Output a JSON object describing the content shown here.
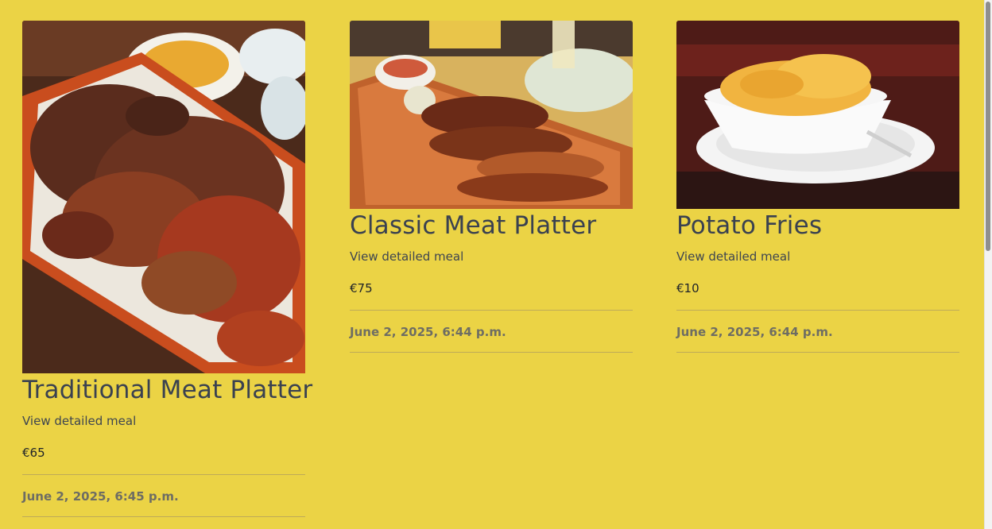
{
  "meals": [
    {
      "title": "Traditional Meat Platter",
      "link_label": "View detailed meal",
      "price": "€65",
      "date": "June 2, 2025, 6:45 p.m.",
      "image_description": "meat-platter-photo"
    },
    {
      "title": "Classic Meat Platter",
      "link_label": "View detailed meal",
      "price": "€75",
      "date": "June 2, 2025, 6:44 p.m.",
      "image_description": "grilled-meat-board-photo"
    },
    {
      "title": "Potato Fries",
      "link_label": "View detailed meal",
      "price": "€10",
      "date": "June 2, 2025, 6:44 p.m.",
      "image_description": "fries-bowl-photo"
    }
  ],
  "colors": {
    "page_background": "#ebd345",
    "title_text": "#3a4150",
    "date_text": "#6e6d63"
  }
}
